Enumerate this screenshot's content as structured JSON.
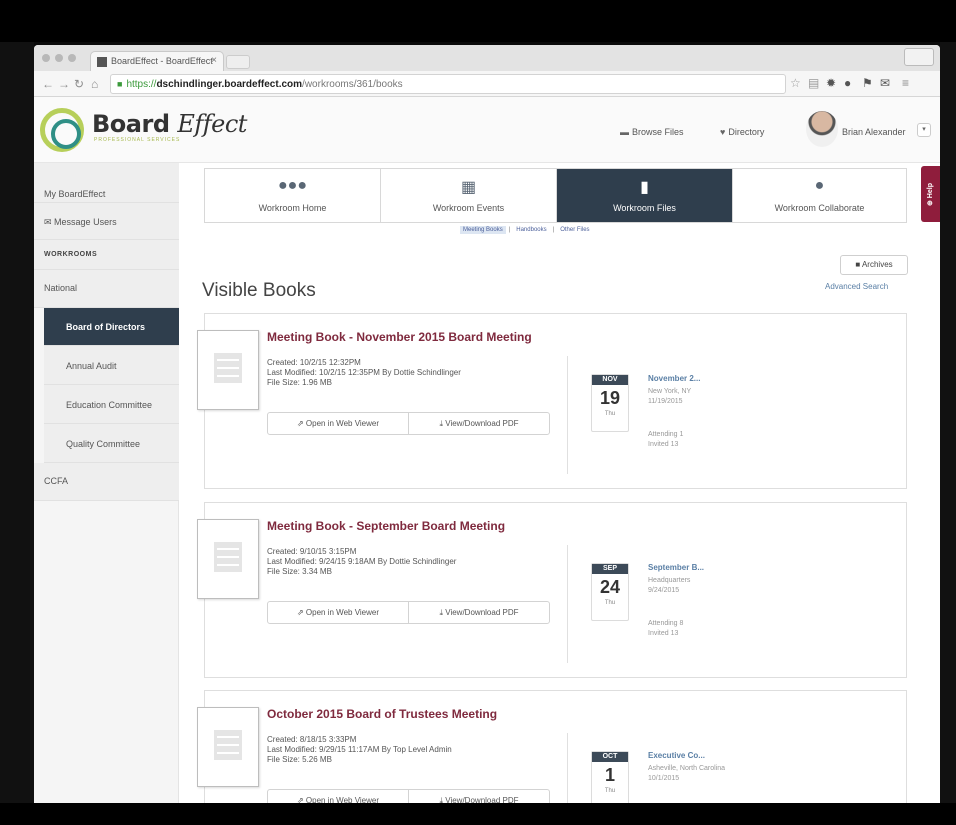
{
  "browser": {
    "tab_title": "BoardEffect - BoardEffect",
    "tab_close": "×",
    "url_scheme": "https://",
    "url_host": "dschindlinger.boardeffect.com",
    "url_path": "/workrooms/361/books"
  },
  "header": {
    "logo_board": "Board",
    "logo_effect": "Effect",
    "logo_tagline": "PROFESSIONAL SERVICES",
    "browse_files": "Browse Files",
    "directory": "Directory",
    "user_name": "Brian Alexander",
    "user_caret": "▾"
  },
  "sidebar": {
    "my_boardeffect": "My BoardEffect",
    "message_users": "Message Users",
    "workrooms_heading": "WORKROOMS",
    "items": [
      "National",
      "Board of Directors",
      "Annual Audit",
      "Education Committee",
      "Quality Committee",
      "CCFA"
    ],
    "active_item": "Board of Directors"
  },
  "workroom_tabs": [
    {
      "label": "Workroom Home",
      "icon": "group-icon"
    },
    {
      "label": "Workroom Events",
      "icon": "calendar-icon"
    },
    {
      "label": "Workroom Files",
      "icon": "file-icon"
    },
    {
      "label": "Workroom Collaborate",
      "icon": "chat-icon"
    }
  ],
  "active_tab": "Workroom Files",
  "help_label": "⊕ Help",
  "subfilter": {
    "meeting_books": "Meeting Books",
    "handbooks": "Handbooks",
    "other_files": "Other Files",
    "separator": "|"
  },
  "archives_label": "Archives",
  "advanced_search": "Advanced Search",
  "page_title": "Visible Books",
  "button_open": "Open in Web Viewer",
  "button_download": "View/Download PDF",
  "books": [
    {
      "title": "Meeting Book - November 2015 Board Meeting",
      "created": "Created: 10/2/15 12:32PM",
      "modified": "Last Modified: 10/2/15 12:35PM By Dottie Schindlinger",
      "size": "File Size: 1.96 MB",
      "event": {
        "month": "NOV",
        "day": "19",
        "dow": "Thu",
        "title": "November 2...",
        "location": "New York, NY",
        "date": "11/19/2015",
        "attending": "Attending 1",
        "invited": "Invited 13"
      }
    },
    {
      "title": "Meeting Book - September Board Meeting",
      "created": "Created: 9/10/15 3:15PM",
      "modified": "Last Modified: 9/24/15 9:18AM By Dottie Schindlinger",
      "size": "File Size: 3.34 MB",
      "event": {
        "month": "SEP",
        "day": "24",
        "dow": "Thu",
        "title": "September B...",
        "location": "Headquarters",
        "date": "9/24/2015",
        "attending": "Attending 8",
        "invited": "Invited 13"
      }
    },
    {
      "title": "October 2015 Board of Trustees Meeting",
      "created": "Created: 8/18/15 3:33PM",
      "modified": "Last Modified: 9/29/15 11:17AM By Top Level Admin",
      "size": "File Size: 5.26 MB",
      "event": {
        "month": "OCT",
        "day": "1",
        "dow": "Thu",
        "title": "Executive Co...",
        "location": "Asheville, North Carolina",
        "date": "10/1/2015",
        "attending": "",
        "invited": ""
      }
    }
  ],
  "colors": {
    "accent_dark": "#2f3e4d",
    "title_maroon": "#7f2a3e",
    "help_red": "#8f1d3c",
    "link_blue": "#5a7fa5",
    "logo_green": "#b7cf5a",
    "logo_teal": "#2f8f86"
  }
}
